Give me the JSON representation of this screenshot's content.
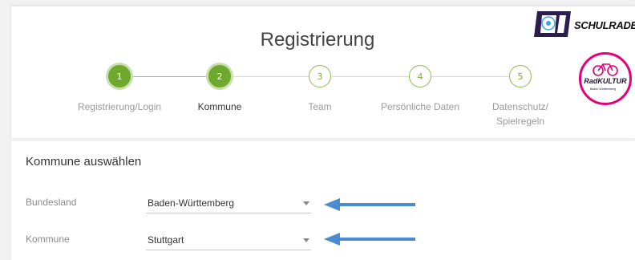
{
  "page": {
    "title": "Registrierung"
  },
  "stepper": {
    "steps": [
      {
        "number": "1",
        "label": "Registrierung/Login",
        "state": "completed"
      },
      {
        "number": "2",
        "label": "Kommune",
        "state": "current"
      },
      {
        "number": "3",
        "label": "Team",
        "state": "pending"
      },
      {
        "number": "4",
        "label": "Persönliche Daten",
        "state": "pending"
      },
      {
        "number": "5",
        "label_line1": "Datenschutz/",
        "label_line2": "Spielregeln",
        "state": "pending"
      }
    ]
  },
  "logos": {
    "schulradeln": {
      "text": "SCHULRADELN",
      "icon": "schulradeln-logo"
    },
    "radkultur": {
      "text": "RadKULTUR",
      "subtext": "Baden-Württemberg",
      "icon": "radkultur-logo"
    }
  },
  "form": {
    "section_title": "Kommune auswählen",
    "fields": [
      {
        "label": "Bundesland",
        "value": "Baden-Württemberg",
        "icon": "chevron-down-icon"
      },
      {
        "label": "Kommune",
        "value": "Stuttgart",
        "icon": "chevron-down-icon"
      }
    ]
  },
  "annotations": {
    "arrow_icon": "arrow-left-icon",
    "arrow_color": "#4a8bd1"
  },
  "colors": {
    "accent": "#6ea82d",
    "logo_pink": "#e3007a",
    "logo_purple": "#2b1d4e"
  }
}
